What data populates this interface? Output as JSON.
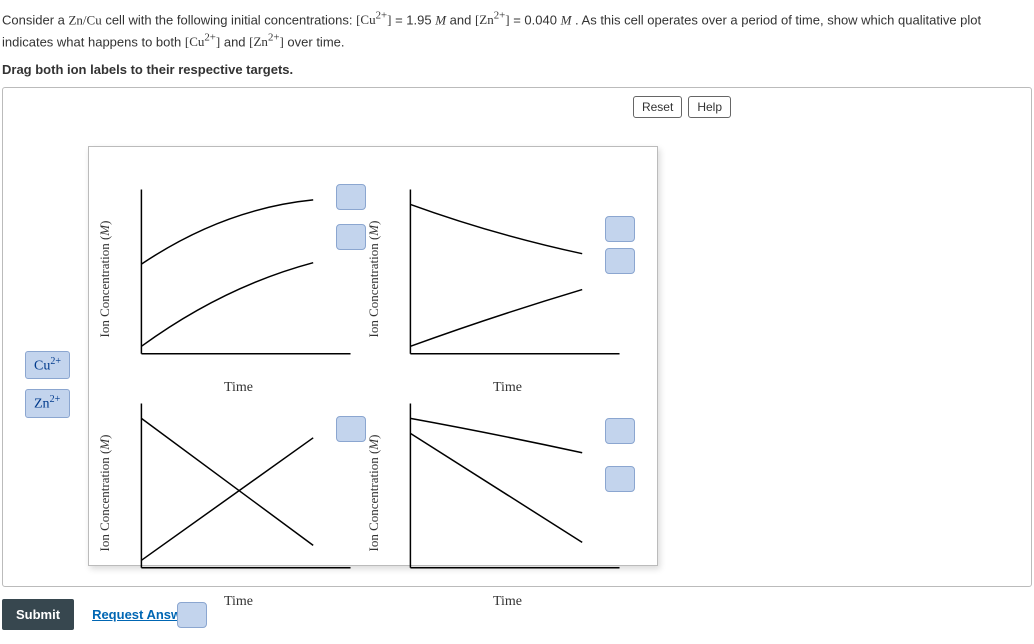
{
  "question": {
    "p1a": "Consider a ",
    "p1b": " cell with the following initial concentrations: ",
    "p1c": " = 1.95 ",
    "p1d": " and ",
    "p1e": " = 0.040 ",
    "p1f": " . As this cell operates over a period of time, show which qualitative plot indicates what happens to both ",
    "p1g": " and ",
    "p1h": " over time.",
    "cell": "Zn/Cu",
    "cu_bracket": "[Cu",
    "zn_bracket": "[Zn",
    "sup": "2+",
    "close_bracket": "]",
    "M": "M"
  },
  "instruction": "Drag both ion labels to their respective targets.",
  "buttons": {
    "reset": "Reset",
    "help": "Help",
    "submit": "Submit",
    "request": "Request Answer"
  },
  "chips": {
    "cu_base": "Cu",
    "zn_base": "Zn",
    "sup": "2+"
  },
  "axes": {
    "y_a": "Ion Concentration (",
    "y_b": ")",
    "y_unit": "M",
    "x": "Time"
  }
}
